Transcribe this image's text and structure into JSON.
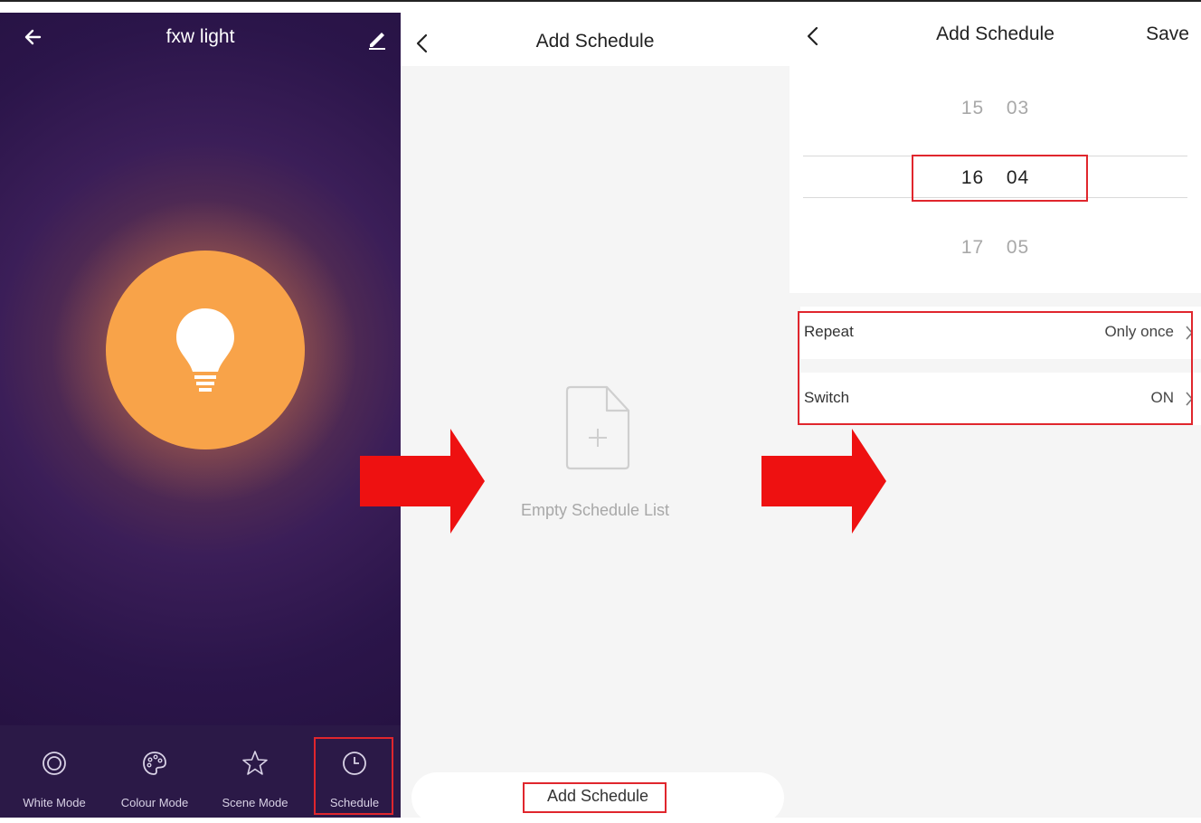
{
  "panel1": {
    "title": "fxw light",
    "icons": {
      "back": "arrow-left-icon",
      "edit": "pencil-icon",
      "bulb": "lightbulb-icon"
    },
    "nav": [
      {
        "label": "White Mode",
        "icon": "ring-icon"
      },
      {
        "label": "Colour Mode",
        "icon": "palette-icon"
      },
      {
        "label": "Scene Mode",
        "icon": "star-icon"
      },
      {
        "label": "Schedule",
        "icon": "clock-icon"
      }
    ],
    "bulb_color": "#f8a349"
  },
  "panel2": {
    "title": "Add Schedule",
    "empty_text": "Empty Schedule List",
    "add_button": "Add Schedule",
    "icons": {
      "back": "chevron-left-icon",
      "empty": "file-plus-icon"
    }
  },
  "panel3": {
    "title": "Add Schedule",
    "save": "Save",
    "picker": {
      "above": {
        "hour": "15",
        "minute": "03"
      },
      "selected": {
        "hour": "16",
        "minute": "04"
      },
      "below": {
        "hour": "17",
        "minute": "05"
      }
    },
    "settings": [
      {
        "label": "Repeat",
        "value": "Only once"
      },
      {
        "label": "Switch",
        "value": "ON"
      }
    ]
  },
  "colors": {
    "highlight": "#e0262d",
    "arrow": "#ee1111"
  }
}
